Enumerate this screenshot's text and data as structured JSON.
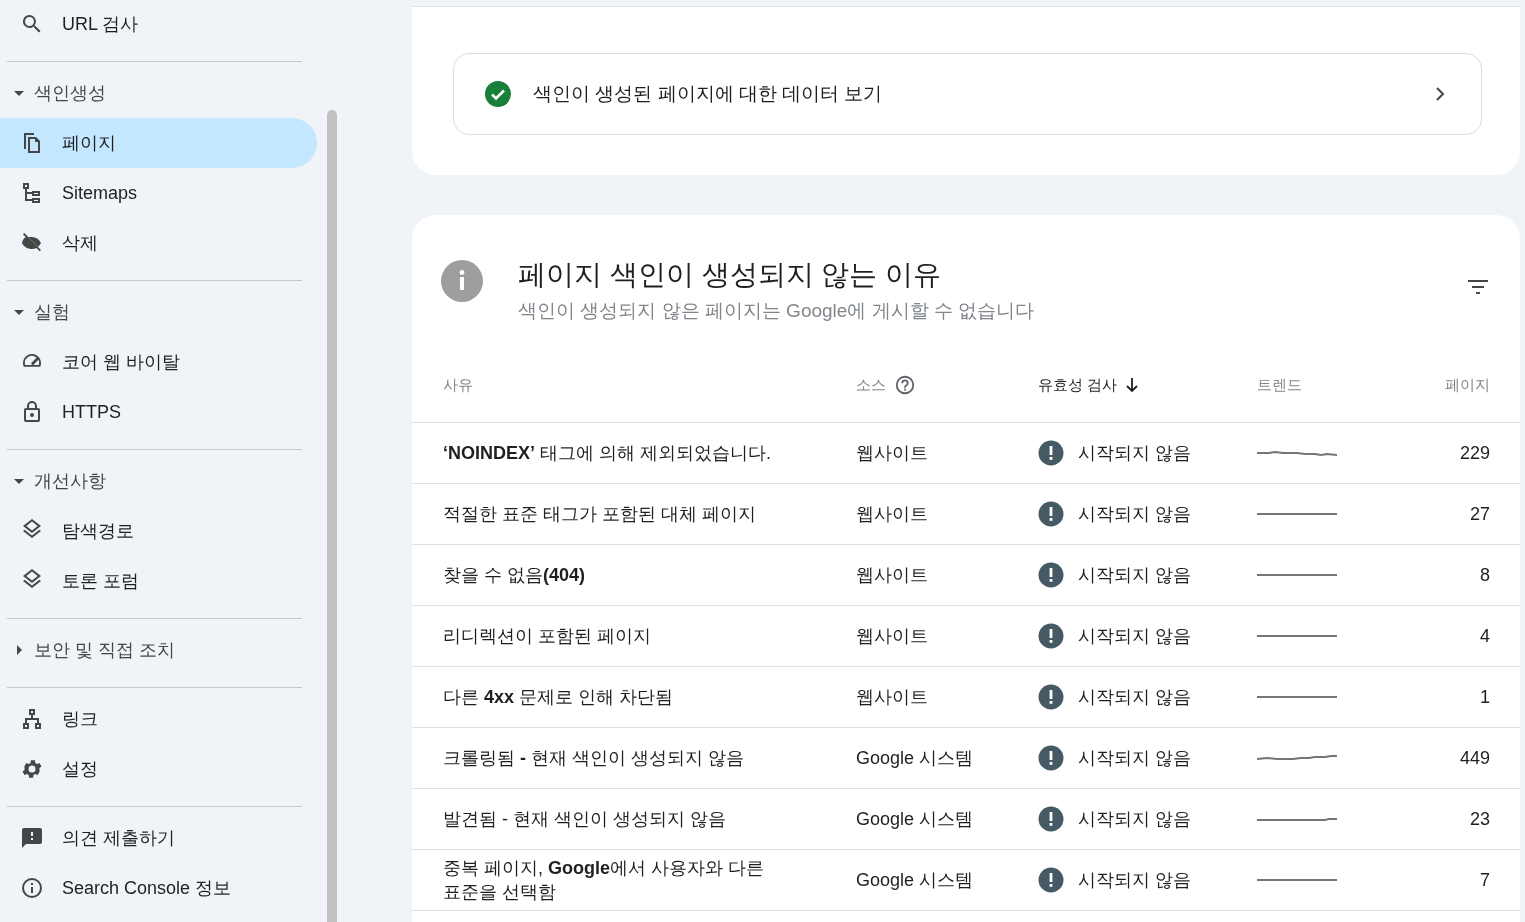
{
  "sidebar": {
    "groups": [
      {
        "items": [
          {
            "label": "URL 검사",
            "selected": false
          }
        ]
      },
      {
        "header": {
          "label": "색인생성",
          "expanded": true
        },
        "items": [
          {
            "label": "페이지",
            "selected": true
          },
          {
            "label": "Sitemaps",
            "selected": false
          },
          {
            "label": "삭제",
            "selected": false
          }
        ]
      },
      {
        "header": {
          "label": "실험",
          "expanded": true
        },
        "items": [
          {
            "label": "코어 웹 바이탈",
            "selected": false
          },
          {
            "label": "HTTPS",
            "selected": false
          }
        ]
      },
      {
        "header": {
          "label": "개선사항",
          "expanded": true
        },
        "items": [
          {
            "label": "탐색경로",
            "selected": false
          },
          {
            "label": "토론 포럼",
            "selected": false
          }
        ]
      },
      {
        "header": {
          "label": "보안 및 직접 조치",
          "expanded": false
        }
      },
      {
        "items": [
          {
            "label": "링크",
            "selected": false
          },
          {
            "label": "설정",
            "selected": false
          }
        ]
      },
      {
        "items": [
          {
            "label": "의견 제출하기",
            "selected": false
          },
          {
            "label": "Search Console 정보",
            "selected": false
          }
        ]
      }
    ]
  },
  "indexed_link": {
    "label": "색인이 생성된 페이지에 대한 데이터 보기"
  },
  "reasons_card": {
    "title": "페이지 색인이 생성되지 않는 이유",
    "subtitle": "색인이 생성되지 않은 페이지는 Google에 게시할 수 없습니다",
    "columns": [
      {
        "label": "사유",
        "sorted": false
      },
      {
        "label": "소스",
        "sorted": false
      },
      {
        "label": "유효성 검사",
        "sorted": true
      },
      {
        "label": "트렌드",
        "sorted": false
      },
      {
        "label": "페이지",
        "sorted": false
      }
    ],
    "rows": [
      {
        "reason": "**‘NOINDEX’** 태그에 의해 제외되었습니다.",
        "source": "웹사이트",
        "validation": "시작되지 않음",
        "pages": "229"
      },
      {
        "reason": "적절한 표준 태그가 포함된 대체 페이지",
        "source": "웹사이트",
        "validation": "시작되지 않음",
        "pages": "27"
      },
      {
        "reason": "찾을 수 없음**(404)**",
        "source": "웹사이트",
        "validation": "시작되지 않음",
        "pages": "8"
      },
      {
        "reason": "리디렉션이 포함된 페이지",
        "source": "웹사이트",
        "validation": "시작되지 않음",
        "pages": "4"
      },
      {
        "reason": "다른 **4xx** 문제로 인해 차단됨",
        "source": "웹사이트",
        "validation": "시작되지 않음",
        "pages": "1"
      },
      {
        "reason": "크롤링됨 **-** 현재 색인이 생성되지 않음",
        "source": "Google 시스템",
        "validation": "시작되지 않음",
        "pages": "449"
      },
      {
        "reason": "발견됨 - 현재 색인이 생성되지 않음",
        "source": "Google 시스템",
        "validation": "시작되지 않음",
        "pages": "23"
      },
      {
        "reason": "중복 페이지, **Google**에서 사용자와 다른 표준을 선택함",
        "source": "Google 시스템",
        "validation": "시작되지 않음",
        "pages": "7"
      }
    ]
  }
}
